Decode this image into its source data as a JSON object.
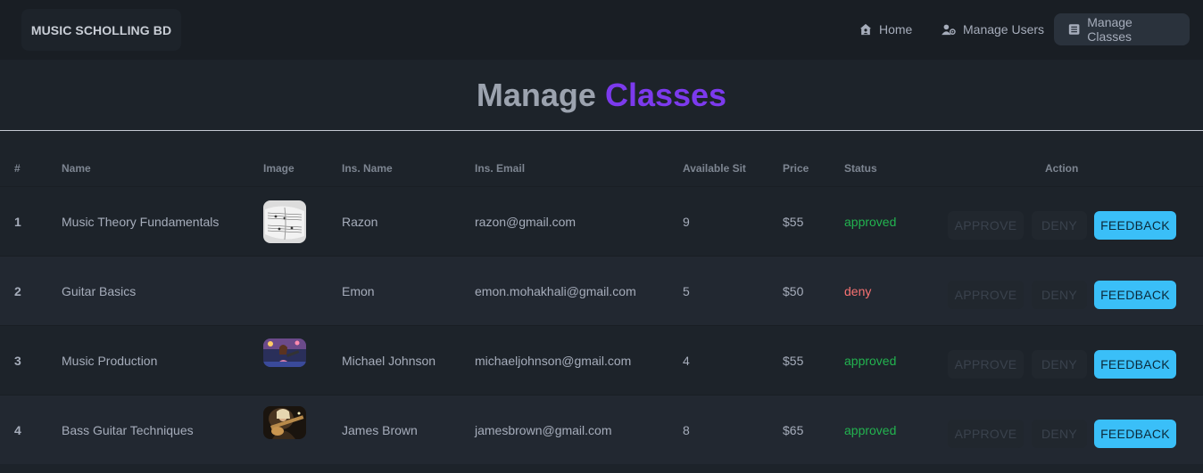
{
  "nav": {
    "brand": "MUSIC SCHOLLING BD",
    "items": [
      {
        "label": "Home",
        "icon": "home-user-icon"
      },
      {
        "label": "Manage Users",
        "icon": "users-gear-icon"
      },
      {
        "label": "Manage Classes",
        "icon": "rectangle-list-icon"
      }
    ]
  },
  "heading": {
    "part1": "Manage",
    "part2": "Classes"
  },
  "table": {
    "headers": [
      "#",
      "Name",
      "Image",
      "Ins. Name",
      "Ins. Email",
      "Available Sit",
      "Price",
      "Status",
      "Action"
    ],
    "rows": [
      {
        "num": "1",
        "name": "Music Theory Fundamentals",
        "image": "sheet-music-photo",
        "ins_name": "Razon",
        "ins_email": "razon@gmail.com",
        "sit": "9",
        "price": "$55",
        "status": "approved"
      },
      {
        "num": "2",
        "name": "Guitar Basics",
        "image": "broken-image",
        "ins_name": "Emon",
        "ins_email": "emon.mohakhali@gmail.com",
        "sit": "5",
        "price": "$50",
        "status": "deny"
      },
      {
        "num": "3",
        "name": "Music Production",
        "image": "performer-photo",
        "ins_name": "Michael Johnson",
        "ins_email": "michaeljohnson@gmail.com",
        "sit": "4",
        "price": "$55",
        "status": "approved"
      },
      {
        "num": "4",
        "name": "Bass Guitar Techniques",
        "image": "bass-player-photo",
        "ins_name": "James Brown",
        "ins_email": "jamesbrown@gmail.com",
        "sit": "8",
        "price": "$65",
        "status": "approved"
      }
    ],
    "actions": {
      "approve": "Approve",
      "deny": "Deny",
      "feedback": "Feedback"
    }
  },
  "colors": {
    "accent": "#7c3aed",
    "feedback": "#3abff8",
    "approved": "#22b34f",
    "deny": "#f87272"
  }
}
